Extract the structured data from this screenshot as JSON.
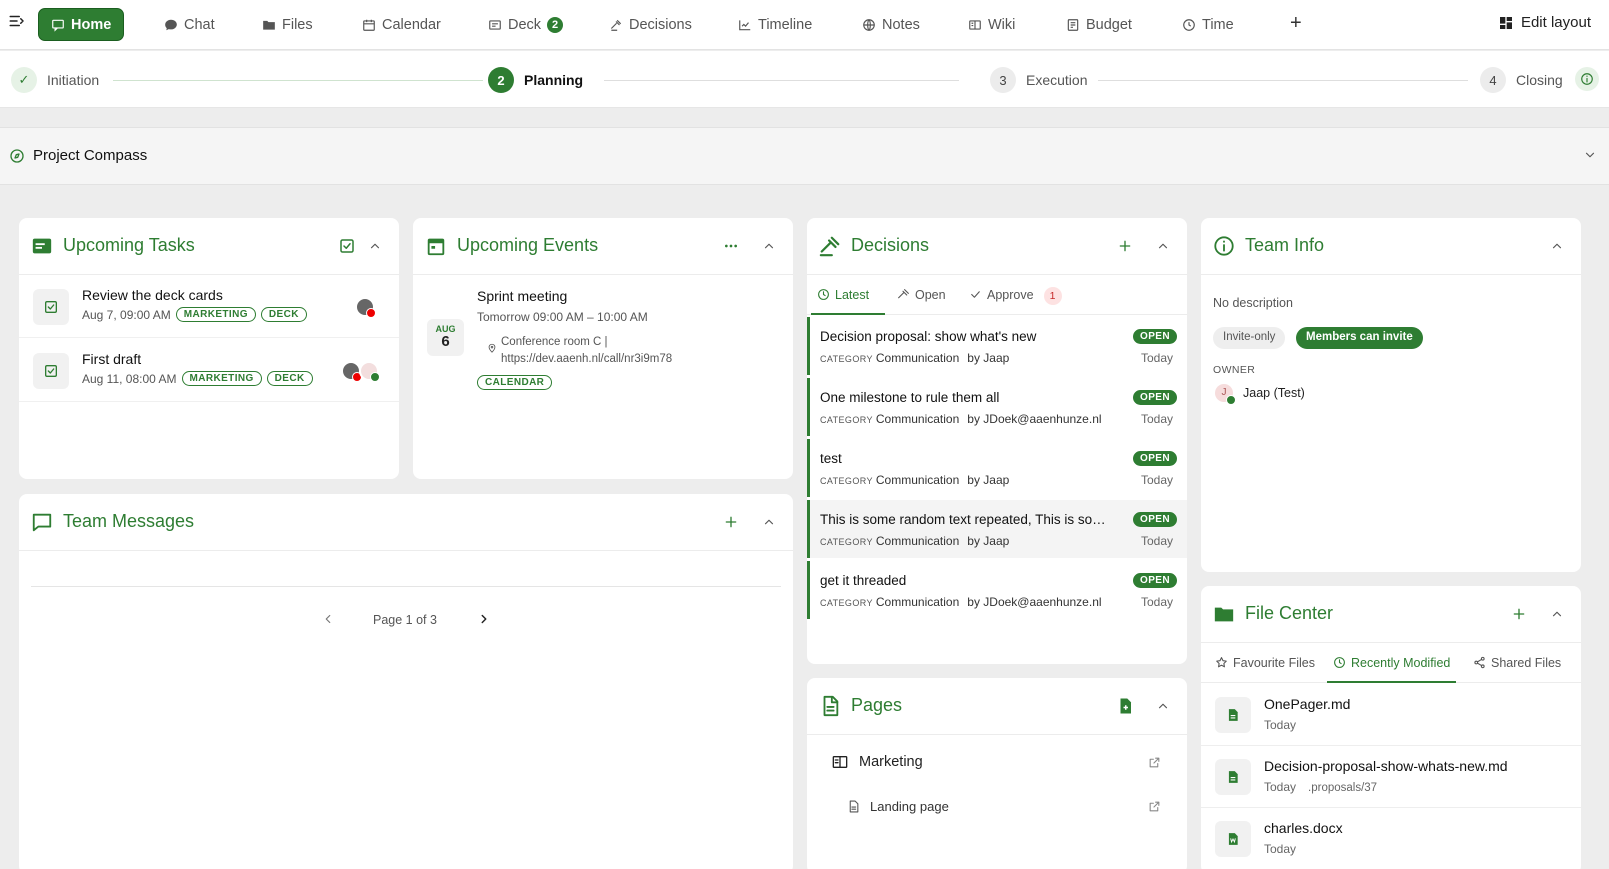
{
  "nav": {
    "items": [
      {
        "label": "Home",
        "icon": "chat-bubble-icon"
      },
      {
        "label": "Chat",
        "icon": "chat-icon"
      },
      {
        "label": "Files",
        "icon": "folder-icon"
      },
      {
        "label": "Calendar",
        "icon": "calendar-icon"
      },
      {
        "label": "Deck",
        "icon": "deck-icon",
        "badge": "2"
      },
      {
        "label": "Decisions",
        "icon": "gavel-icon"
      },
      {
        "label": "Timeline",
        "icon": "timeline-icon"
      },
      {
        "label": "Notes",
        "icon": "globe-icon"
      },
      {
        "label": "Wiki",
        "icon": "book-icon"
      },
      {
        "label": "Budget",
        "icon": "budget-icon"
      },
      {
        "label": "Time",
        "icon": "clock-icon"
      }
    ],
    "add_symbol": "+",
    "edit_layout": "Edit layout"
  },
  "stepper": {
    "steps": [
      {
        "num": "✓",
        "label": "Initiation",
        "state": "done"
      },
      {
        "num": "2",
        "label": "Planning",
        "state": "current"
      },
      {
        "num": "3",
        "label": "Execution",
        "state": "todo"
      },
      {
        "num": "4",
        "label": "Closing",
        "state": "todo"
      }
    ]
  },
  "project": {
    "title": "Project Compass"
  },
  "tasks": {
    "title": "Upcoming Tasks",
    "items": [
      {
        "title": "Review the deck cards",
        "date": "Aug 7, 09:00 AM",
        "tags": [
          "MARKETING",
          "DECK"
        ]
      },
      {
        "title": "First draft",
        "date": "Aug 11, 08:00 AM",
        "tags": [
          "MARKETING",
          "DECK"
        ]
      }
    ]
  },
  "events": {
    "title": "Upcoming Events",
    "items": [
      {
        "month": "AUG",
        "day": "6",
        "title": "Sprint meeting",
        "time": "Tomorrow 09:00 AM – 10:00 AM",
        "location_1": "Conference room C |",
        "location_2": "https://dev.aaenh.nl/call/nr3i9m78",
        "tag": "CALENDAR"
      }
    ]
  },
  "decisions": {
    "title": "Decisions",
    "tabs": [
      {
        "label": "Latest"
      },
      {
        "label": "Open"
      },
      {
        "label": "Approve",
        "badge": "1"
      }
    ],
    "category_label": "CATEGORY",
    "items": [
      {
        "title": "Decision proposal: show what's new",
        "category": "Communication",
        "by": "by Jaap",
        "status": "OPEN",
        "when": "Today"
      },
      {
        "title": "One milestone to rule them all",
        "category": "Communication",
        "by": "by JDoek@aaenhunze.nl",
        "status": "OPEN",
        "when": "Today"
      },
      {
        "title": "test",
        "category": "Communication",
        "by": "by Jaap",
        "status": "OPEN",
        "when": "Today"
      },
      {
        "title": "This is some random text repeated, This is some random text repeated",
        "category": "Communication",
        "by": "by Jaap",
        "status": "OPEN",
        "when": "Today"
      },
      {
        "title": "get it threaded",
        "category": "Communication",
        "by": "by JDoek@aaenhunze.nl",
        "status": "OPEN",
        "when": "Today"
      }
    ]
  },
  "team_info": {
    "title": "Team Info",
    "description": "No description",
    "pills": [
      "Invite-only",
      "Members can invite"
    ],
    "owner_label": "OWNER",
    "owner_name": "Jaap (Test)",
    "owner_initial": "J"
  },
  "messages": {
    "title": "Team Messages",
    "pagination": "Page 1 of 3"
  },
  "pages": {
    "title": "Pages",
    "items": [
      {
        "label": "Marketing"
      },
      {
        "label": "Landing page"
      }
    ]
  },
  "files": {
    "title": "File Center",
    "tabs": [
      "Favourite Files",
      "Recently Modified",
      "Shared Files"
    ],
    "items": [
      {
        "name": "OnePager.md",
        "meta": "Today",
        "path": ""
      },
      {
        "name": "Decision-proposal-show-whats-new.md",
        "meta": "Today",
        "path": ".proposals/37"
      },
      {
        "name": "charles.docx",
        "meta": "Today",
        "path": ""
      }
    ]
  },
  "colors": {
    "accent": "#2e7d32",
    "accent_light": "#e6f2e6",
    "alert": "#c62828"
  }
}
